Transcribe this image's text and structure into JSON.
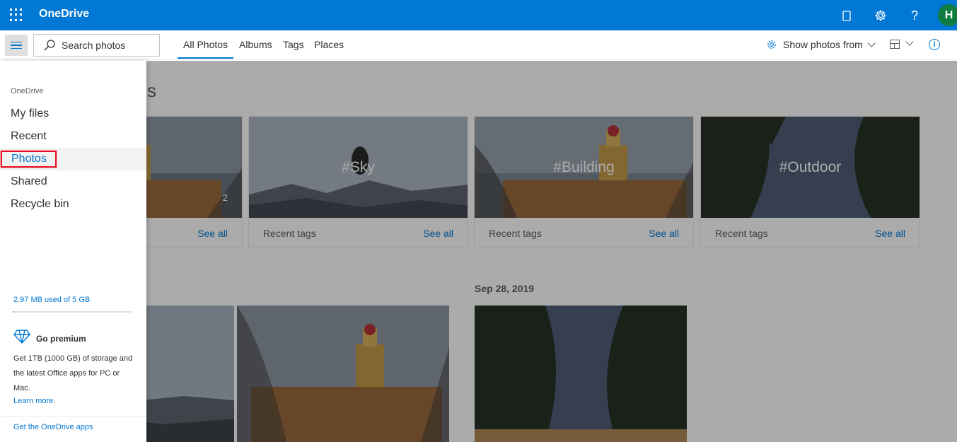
{
  "header": {
    "brand": "OneDrive",
    "avatar_initial": "H",
    "accent": "#0078d4"
  },
  "icons": {
    "waffle": "waffle-icon",
    "feedback": "feedback-icon",
    "settings": "gear-icon",
    "help": "help-icon",
    "hamburger": "hamburger-icon",
    "search": "search-icon",
    "view": "layout-icon",
    "info": "info-icon"
  },
  "toolbar": {
    "search_placeholder": "Search photos",
    "tabs": [
      {
        "label": "All Photos",
        "active": true
      },
      {
        "label": "Albums"
      },
      {
        "label": "Tags"
      },
      {
        "label": "Places"
      }
    ],
    "show_photos_from": "Show photos from"
  },
  "main": {
    "title": "Photos",
    "cards": [
      {
        "tag": "",
        "count": "2",
        "footer_label": "",
        "footer_link": "See all"
      },
      {
        "tag": "#Sky",
        "footer_label": "Recent tags",
        "footer_link": "See all"
      },
      {
        "tag": "#Building",
        "footer_label": "Recent tags",
        "footer_link": "See all"
      },
      {
        "tag": "#Outdoor",
        "footer_label": "Recent tags",
        "footer_link": "See all"
      }
    ],
    "date_group": "Sep 28, 2019"
  },
  "nav": {
    "section": "OneDrive",
    "items": [
      {
        "label": "My files"
      },
      {
        "label": "Recent"
      },
      {
        "label": "Photos",
        "selected": true
      },
      {
        "label": "Shared"
      },
      {
        "label": "Recycle bin"
      }
    ],
    "storage_text": "2.97 MB used of 5 GB",
    "storage_used_fraction": 0.0006,
    "premium_title": "Go premium",
    "premium_desc": "Get 1TB (1000 GB) of storage and the latest Office apps for PC or Mac.",
    "learn_more": "Learn more.",
    "get_apps": "Get the OneDrive apps"
  }
}
